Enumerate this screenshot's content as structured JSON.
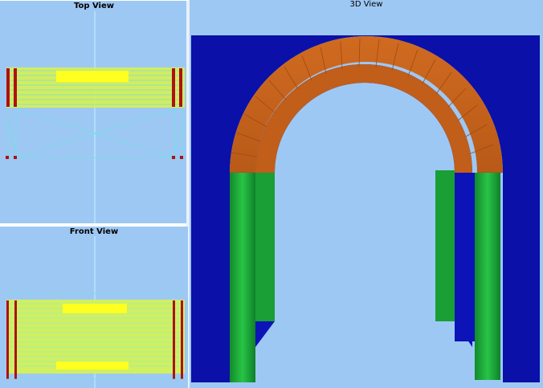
{
  "views": {
    "top": {
      "title": "Top View"
    },
    "front": {
      "title": "Front View"
    },
    "three_d": {
      "title": "3D View"
    }
  },
  "colors": {
    "viewport_bg": "#9ec8f4",
    "wall": "#0a10a8",
    "arch_brick": "#c8621c",
    "pillar": "#1ea83a",
    "wireframe": "#ffff33",
    "post": "#a01010"
  }
}
